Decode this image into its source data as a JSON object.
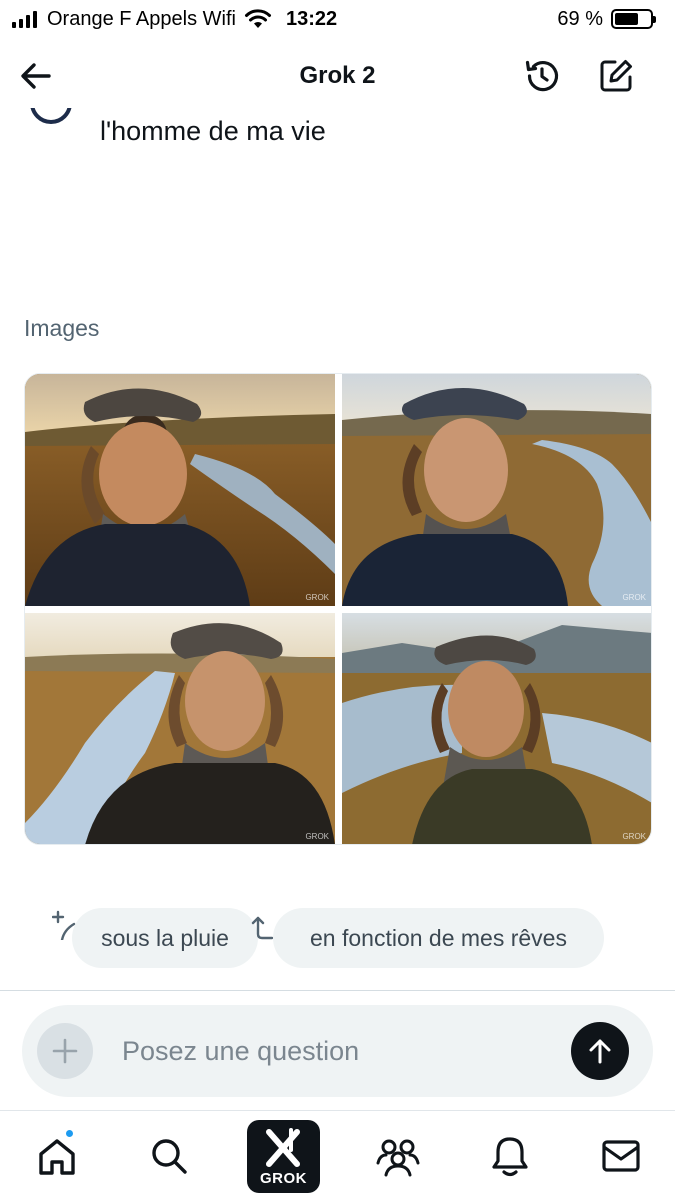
{
  "status_bar": {
    "carrier": "Orange F Appels Wifi",
    "time": "13:22",
    "battery": "69 %",
    "battery_level": 0.69
  },
  "header": {
    "title": "Grok 2",
    "icons": {
      "back": "arrow-left-icon",
      "history": "history-icon",
      "compose": "new-chat-icon"
    }
  },
  "previous_message": {
    "text": "l'homme de ma vie"
  },
  "images_section": {
    "label": "Images",
    "watermark": "GROK",
    "images": [
      {
        "name": "generated-image-1",
        "subject": "man-in-flat-cap-river-meadow"
      },
      {
        "name": "generated-image-2",
        "subject": "man-in-flat-cap-river-meadow"
      },
      {
        "name": "generated-image-3",
        "subject": "man-in-flat-cap-river-meadow"
      },
      {
        "name": "generated-image-4",
        "subject": "man-in-flat-cap-river-meadow"
      }
    ]
  },
  "suggestions": [
    {
      "label": "sous la pluie",
      "icon": "sparkle-pen-icon"
    },
    {
      "label": "en fonction de mes rêves",
      "icon": "refresh-arrows-icon"
    }
  ],
  "composer": {
    "placeholder": "Posez une question",
    "value": "",
    "icons": {
      "attach": "plus-icon",
      "send": "arrow-up-icon"
    }
  },
  "bottom_nav": {
    "grok_label": "GROK",
    "items": [
      "home-icon",
      "search-icon",
      "grok-icon",
      "communities-icon",
      "notifications-icon",
      "messages-icon"
    ]
  },
  "colors": {
    "text": "#0f1419",
    "secondary_text": "#536471",
    "chip_bg": "#eff3f4",
    "notification_dot": "#1d9bf0"
  }
}
